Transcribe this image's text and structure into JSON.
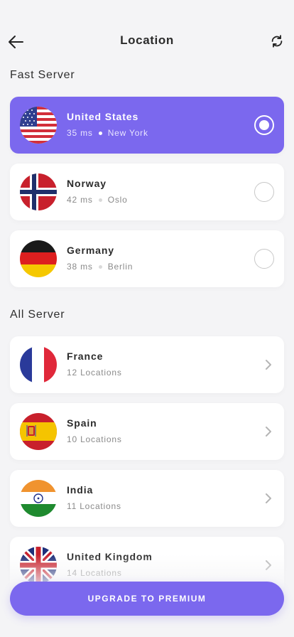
{
  "header": {
    "title": "Location",
    "back_icon": "arrow-left-icon",
    "refresh_icon": "refresh-icon"
  },
  "fast_server": {
    "section_title": "Fast Server",
    "items": [
      {
        "country": "United States",
        "ping": "35 ms",
        "city": "New York",
        "selected": true,
        "flag": "us-flag-icon"
      },
      {
        "country": "Norway",
        "ping": "42 ms",
        "city": "Oslo",
        "selected": false,
        "flag": "norway-flag-icon"
      },
      {
        "country": "Germany",
        "ping": "38 ms",
        "city": "Berlin",
        "selected": false,
        "flag": "germany-flag-icon"
      }
    ]
  },
  "all_server": {
    "section_title": "All Server",
    "items": [
      {
        "country": "France",
        "locations": "12 Locations",
        "flag": "france-flag-icon"
      },
      {
        "country": "Spain",
        "locations": "10 Locations",
        "flag": "spain-flag-icon"
      },
      {
        "country": "India",
        "locations": "11 Locations",
        "flag": "india-flag-icon"
      },
      {
        "country": "United Kingdom",
        "locations": "14 Locations",
        "flag": "uk-flag-icon"
      }
    ]
  },
  "upgrade_button": {
    "label": "UPGRADE TO PREMIUM"
  },
  "colors": {
    "accent": "#7b68ee",
    "background": "#f4f4f6",
    "card": "#ffffff"
  }
}
